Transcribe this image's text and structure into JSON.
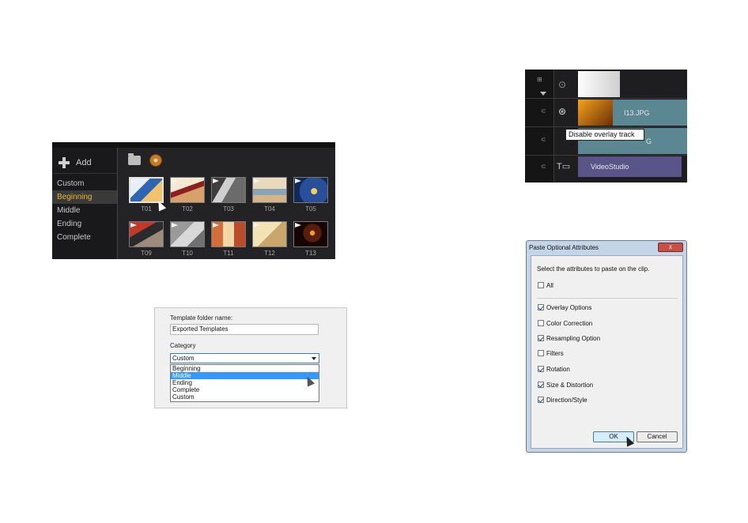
{
  "library": {
    "add_label": "Add",
    "categories": [
      {
        "label": "Custom",
        "selected": false
      },
      {
        "label": "Beginning",
        "selected": true
      },
      {
        "label": "Middle",
        "selected": false
      },
      {
        "label": "Ending",
        "selected": false
      },
      {
        "label": "Complete",
        "selected": false
      }
    ],
    "row1": [
      "T01",
      "T02",
      "T03",
      "T04",
      "T05"
    ],
    "row2": [
      "T09",
      "T10",
      "T11",
      "T12",
      "T13"
    ]
  },
  "template_dialog": {
    "folder_label": "Template folder name:",
    "folder_value": "Exported Templates",
    "category_label": "Category",
    "category_value": "Custom",
    "options": [
      "Beginning",
      "Middle",
      "Ending",
      "Complete",
      "Custom"
    ],
    "highlighted": "Middle"
  },
  "timeline": {
    "clip1_label": "I13.JPG",
    "clip2_label": "I13.JPG",
    "clip2_partial": "G",
    "title_clip_label": "VideoStudio",
    "tooltip": "Disable overlay track"
  },
  "paste_dialog": {
    "title": "Paste Optional Attributes",
    "close_symbol": "x",
    "description": "Select the attributes to paste on the clip.",
    "all_label": "All",
    "all_checked": false,
    "options": [
      {
        "label": "Overlay Options",
        "checked": true
      },
      {
        "label": "Color Correction",
        "checked": false
      },
      {
        "label": "Resampling Option",
        "checked": true
      },
      {
        "label": "Filters",
        "checked": false
      },
      {
        "label": "Rotation",
        "checked": true
      },
      {
        "label": "Size & Distortion",
        "checked": true
      },
      {
        "label": "Direction/Style",
        "checked": true
      }
    ],
    "ok_label": "OK",
    "cancel_label": "Cancel"
  },
  "colors": {
    "accent_gold": "#e9b52d",
    "timeline_video": "#5a8791",
    "timeline_title": "#5a5588",
    "selection_blue": "#3399ff"
  }
}
